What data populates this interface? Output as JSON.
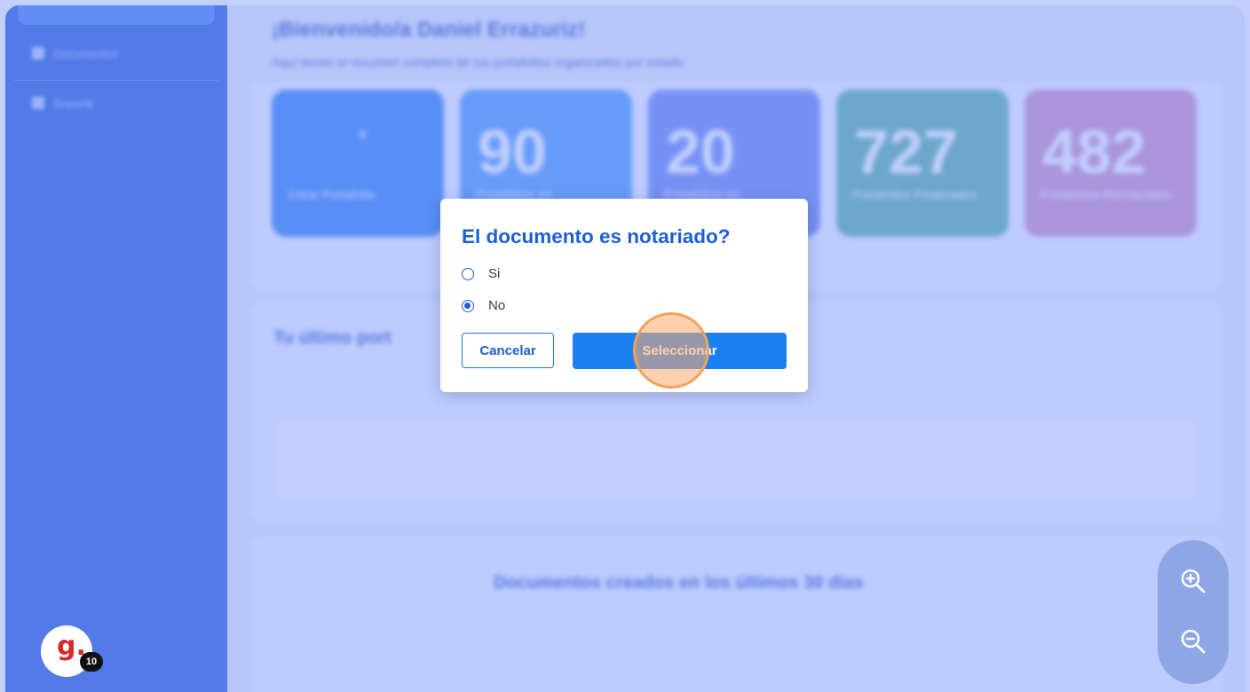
{
  "sidebar": {
    "items": [
      {
        "label": "Documentos"
      },
      {
        "label": "Soporte"
      }
    ]
  },
  "background": {
    "welcome": "¡Bienvenido/a Daniel Errazuriz!",
    "subtitle": "Aquí tienes el resumen completo de tus portafolios organizados por estado",
    "cards": [
      {
        "value": "+",
        "label": "Crear Portafolio",
        "color": "#4a8ff0"
      },
      {
        "value": "90",
        "label": "Portafolios en",
        "color": "#63a6f6"
      },
      {
        "value": "20",
        "label": "Portafolios en",
        "color": "#7c95ee"
      },
      {
        "value": "727",
        "label": "Portafolios Finalizados",
        "color": "#6dbaa9"
      },
      {
        "value": "482",
        "label": "Portafolios Rechazados",
        "color": "#d79bc4"
      }
    ],
    "last_title": "Tu último port",
    "chart_title": "Documentos creados en los últimos 30 días"
  },
  "modal": {
    "title": "El documento es notariado?",
    "options": [
      {
        "label": "Si",
        "checked": false
      },
      {
        "label": "No",
        "checked": true
      }
    ],
    "cancel_label": "Cancelar",
    "select_label": "Seleccionar"
  },
  "zoom": {
    "in_icon": "zoom-in-icon",
    "out_icon": "zoom-out-icon"
  },
  "logo": {
    "letter": "g.",
    "badge_count": "10"
  },
  "colors": {
    "accent": "#1b80f2",
    "title": "#1b5fd6",
    "sidebar": "#3f6fd8"
  }
}
